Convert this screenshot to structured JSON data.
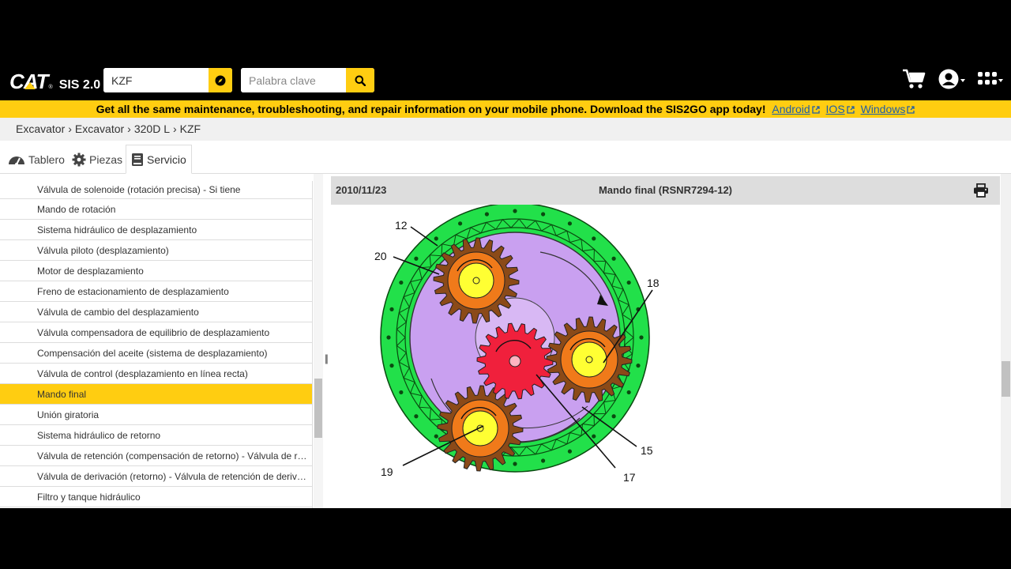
{
  "app": {
    "logo_text": "CAT",
    "logo_reg": "®",
    "product": "SIS 2.0"
  },
  "search": {
    "serial_value": "KZF",
    "keyword_placeholder": "Palabra clave"
  },
  "banner": {
    "message": "Get all the same maintenance, troubleshooting, and repair information on your mobile phone. Download the SIS2GO app today!",
    "links": [
      "Android",
      "IOS",
      "Windows"
    ]
  },
  "breadcrumb": [
    "Excavator",
    "Excavator",
    "320D L",
    "KZF"
  ],
  "tabs": [
    {
      "label": "Tablero",
      "icon": "dashboard-icon"
    },
    {
      "label": "Piezas",
      "icon": "gear-icon"
    },
    {
      "label": "Servicio",
      "icon": "book-icon",
      "active": true
    }
  ],
  "service_list": [
    "Válvula de solenoide (rotación precisa) - Si tiene",
    "Mando de rotación",
    "Sistema hidráulico de desplazamiento",
    "Válvula piloto (desplazamiento)",
    "Motor de desplazamiento",
    "Freno de estacionamiento de desplazamiento",
    "Válvula de cambio del desplazamiento",
    "Válvula compensadora de equilibrio de desplazamiento",
    "Compensación del aceite (sistema de desplazamiento)",
    "Válvula de control (desplazamiento en línea recta)",
    "Mando final",
    "Unión giratoria",
    "Sistema hidráulico de retorno",
    "Válvula de retención (compensación de retorno) - Válvula de retención",
    "Válvula de derivación (retorno) - Válvula de retención de derivación",
    "Filtro y tanque hidráulico"
  ],
  "active_item_index": 10,
  "document": {
    "date": "2010/11/23",
    "title": "Mando final (RSNR7294-12)"
  },
  "diagram_callouts": [
    "12",
    "20",
    "18",
    "15",
    "17",
    "19"
  ],
  "colors": {
    "brand_yellow": "#ffcd11",
    "ring_green": "#22e04a",
    "carrier_purple": "#c9a0f0",
    "sun_red": "#f0203c",
    "planet_brown": "#8b4a18",
    "planet_orange": "#f07a1a",
    "hub_yellow": "#ffff33"
  }
}
